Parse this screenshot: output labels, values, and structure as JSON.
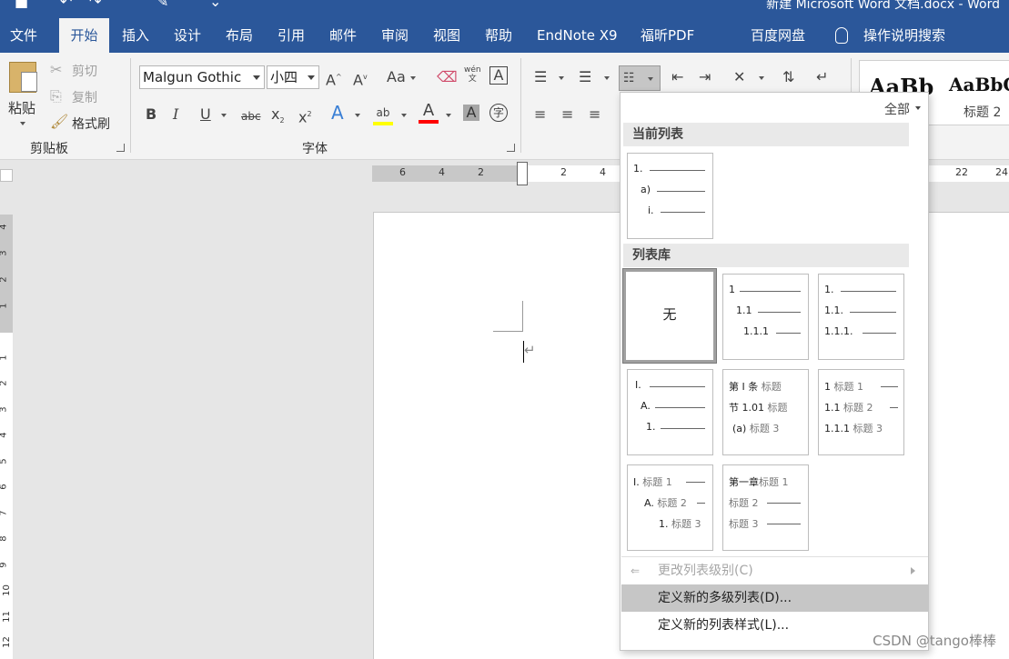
{
  "window": {
    "title": "新建 Microsoft Word 文档.docx  -  Word"
  },
  "tabs": [
    {
      "label": "文件"
    },
    {
      "label": "开始"
    },
    {
      "label": "插入"
    },
    {
      "label": "设计"
    },
    {
      "label": "布局"
    },
    {
      "label": "引用"
    },
    {
      "label": "邮件"
    },
    {
      "label": "审阅"
    },
    {
      "label": "视图"
    },
    {
      "label": "帮助"
    },
    {
      "label": "EndNote X9"
    },
    {
      "label": "福昕PDF"
    },
    {
      "label": "百度网盘"
    }
  ],
  "tell_me": {
    "label": "操作说明搜索"
  },
  "clipboard": {
    "paste": "粘贴",
    "cut": "剪切",
    "copy": "复制",
    "format_painter": "格式刷",
    "group": "剪贴板"
  },
  "font": {
    "name": "Malgun Gothic",
    "size": "小四",
    "group": "字体",
    "change_case": "Aa",
    "phonetic": "wén",
    "highlight": "ab",
    "color_a": "A"
  },
  "styles": {
    "preview_1": "AaBb",
    "preview_2": "AaBbC",
    "heading2": "标题 2"
  },
  "ruler": {
    "h_left": [
      "6",
      "4",
      "2"
    ],
    "h_right": [
      "2",
      "4",
      "22",
      "24"
    ],
    "v_top": [
      "4",
      "3",
      "2",
      "1"
    ],
    "v_bottom": [
      "1",
      "2",
      "3",
      "4",
      "5",
      "6",
      "7",
      "8",
      "9",
      "10",
      "11",
      "12"
    ]
  },
  "document": {
    "para_mark": "↵"
  },
  "list_menu": {
    "filter": "全部",
    "current_header": "当前列表",
    "library_header": "列表库",
    "current": {
      "l1": "1.",
      "l2": "a)",
      "l3": "i."
    },
    "none_label": "无",
    "lib2": {
      "l1": "1",
      "l2": "1.1",
      "l3": "1.1.1"
    },
    "lib3": {
      "l1": "1.",
      "l2": "1.1.",
      "l3": "1.1.1."
    },
    "lib4": {
      "l1": "I.",
      "l2": "A.",
      "l3": "1."
    },
    "lib5": {
      "p1": "第 I 条",
      "t1": "标题",
      "p2": "节 1.01",
      "t2": "标题",
      "p3": "(a)",
      "t3": "标题 3"
    },
    "lib6": {
      "p1": "1",
      "t1": "标题 1",
      "p2": "1.1",
      "t2": "标题 2",
      "p3": "1.1.1",
      "t3": "标题 3"
    },
    "lib7": {
      "p1": "I.",
      "t1": "标题 1",
      "p2": "A.",
      "t2": "标题 2",
      "p3": "1.",
      "t3": "标题 3"
    },
    "lib8": {
      "p1": "第一章",
      "t1": "标题 1",
      "t2": "标题 2",
      "t3": "标题 3"
    },
    "change_level": "更改列表级别(C)",
    "define_multilevel": "定义新的多级列表(D)...",
    "define_style": "定义新的列表样式(L)..."
  },
  "watermark": "CSDN @tango棒棒"
}
